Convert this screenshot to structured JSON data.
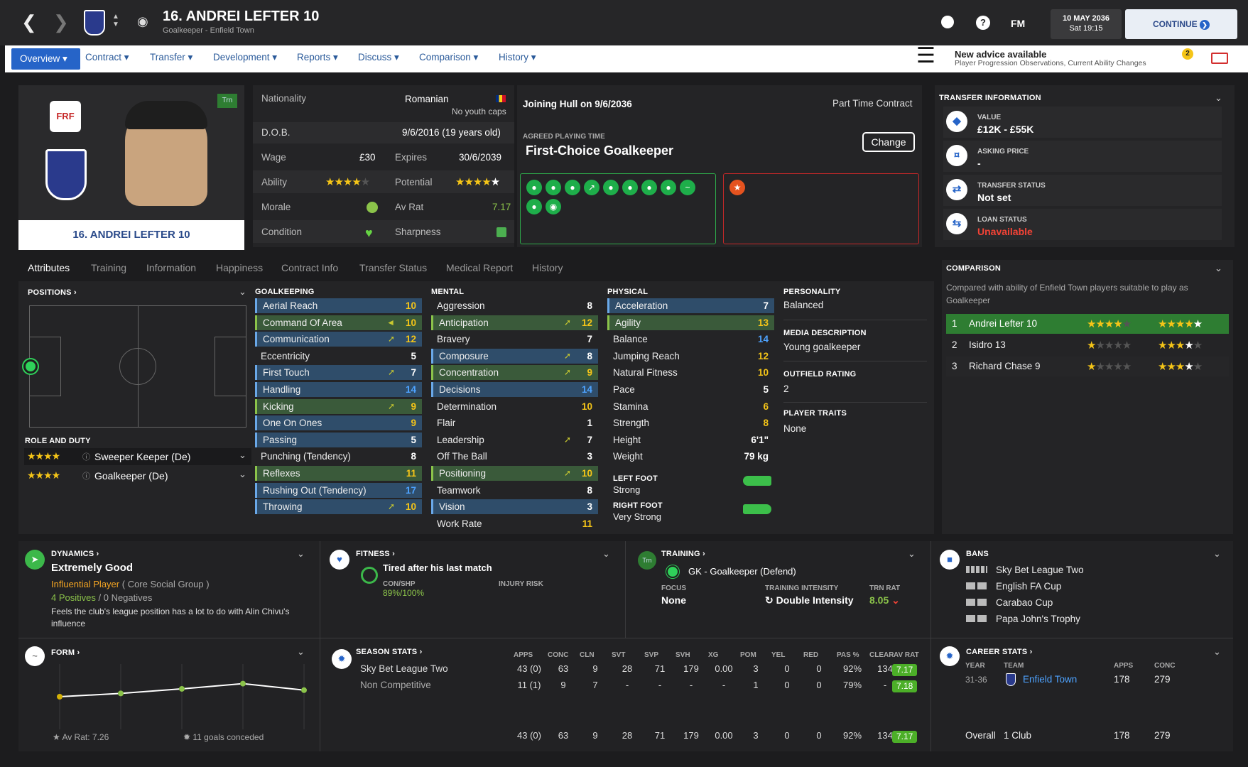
{
  "header": {
    "title": "16. ANDREI LEFTER 10",
    "subtitle": "Goalkeeper - Enfield Town",
    "fm": "FM",
    "date": "10 MAY 2036",
    "time": "Sat 19:15",
    "continue": "CONTINUE"
  },
  "menu": [
    "Overview",
    "Contract",
    "Transfer",
    "Development",
    "Reports",
    "Discuss",
    "Comparison",
    "History"
  ],
  "advice": {
    "title": "New advice available",
    "sub": "Player Progression Observations, Current Ability Changes",
    "count": "2"
  },
  "profile": {
    "name_plate": "16. ANDREI LEFTER 10",
    "trn": "Trn"
  },
  "info": {
    "nationality_label": "Nationality",
    "nationality": "Romanian",
    "youth_caps": "No youth caps",
    "dob_label": "D.O.B.",
    "dob": "9/6/2016 (19 years old)",
    "wage_label": "Wage",
    "wage": "£30",
    "expires_label": "Expires",
    "expires": "30/6/2039",
    "ability_label": "Ability",
    "potential_label": "Potential",
    "morale_label": "Morale",
    "avrat_label": "Av Rat",
    "avrat": "7.17",
    "condition_label": "Condition",
    "sharpness_label": "Sharpness"
  },
  "contract": {
    "joining": "Joining Hull on 9/6/2036",
    "type": "Part Time Contract",
    "apt_label": "AGREED PLAYING TIME",
    "apt": "First-Choice Goalkeeper",
    "change": "Change"
  },
  "transfer": {
    "header": "TRANSFER INFORMATION",
    "value_label": "VALUE",
    "value": "£12K - £55K",
    "asking_label": "ASKING PRICE",
    "asking": "-",
    "status_label": "TRANSFER STATUS",
    "status": "Not set",
    "loan_label": "LOAN STATUS",
    "loan": "Unavailable"
  },
  "comparison": {
    "header": "COMPARISON",
    "desc": "Compared with ability of Enfield Town players suitable to play as Goalkeeper",
    "rows": [
      {
        "rank": "1",
        "name": "Andrei Lefter 10"
      },
      {
        "rank": "2",
        "name": "Isidro 13"
      },
      {
        "rank": "3",
        "name": "Richard Chase 9"
      }
    ]
  },
  "tabs": [
    "Attributes",
    "Training",
    "Information",
    "Happiness",
    "Contract Info",
    "Transfer Status",
    "Medical Report",
    "History"
  ],
  "positions": {
    "header": "POSITIONS",
    "role_header": "ROLE AND DUTY",
    "roles": [
      "Sweeper Keeper (De)",
      "Goalkeeper (De)"
    ]
  },
  "goalkeeping": {
    "header": "GOALKEEPING",
    "items": [
      [
        "Aerial Reach",
        "10"
      ],
      [
        "Command Of Area",
        "10"
      ],
      [
        "Communication",
        "12"
      ],
      [
        "Eccentricity",
        "5"
      ],
      [
        "First Touch",
        "7"
      ],
      [
        "Handling",
        "14"
      ],
      [
        "Kicking",
        "9"
      ],
      [
        "One On Ones",
        "9"
      ],
      [
        "Passing",
        "5"
      ],
      [
        "Punching (Tendency)",
        "8"
      ],
      [
        "Reflexes",
        "11"
      ],
      [
        "Rushing Out (Tendency)",
        "17"
      ],
      [
        "Throwing",
        "10"
      ]
    ]
  },
  "mental": {
    "header": "MENTAL",
    "items": [
      [
        "Aggression",
        "8"
      ],
      [
        "Anticipation",
        "12"
      ],
      [
        "Bravery",
        "7"
      ],
      [
        "Composure",
        "8"
      ],
      [
        "Concentration",
        "9"
      ],
      [
        "Decisions",
        "14"
      ],
      [
        "Determination",
        "10"
      ],
      [
        "Flair",
        "1"
      ],
      [
        "Leadership",
        "7"
      ],
      [
        "Off The Ball",
        "3"
      ],
      [
        "Positioning",
        "10"
      ],
      [
        "Teamwork",
        "8"
      ],
      [
        "Vision",
        "3"
      ],
      [
        "Work Rate",
        "11"
      ]
    ]
  },
  "physical": {
    "header": "PHYSICAL",
    "items": [
      [
        "Acceleration",
        "7"
      ],
      [
        "Agility",
        "13"
      ],
      [
        "Balance",
        "14"
      ],
      [
        "Jumping Reach",
        "12"
      ],
      [
        "Natural Fitness",
        "10"
      ],
      [
        "Pace",
        "5"
      ],
      [
        "Stamina",
        "6"
      ],
      [
        "Strength",
        "8"
      ],
      [
        "Height",
        "6'1\""
      ],
      [
        "Weight",
        "79 kg"
      ]
    ],
    "left_foot_label": "LEFT FOOT",
    "left_foot": "Strong",
    "right_foot_label": "RIGHT FOOT",
    "right_foot": "Very Strong"
  },
  "personality": {
    "p_label": "PERSONALITY",
    "p": "Balanced",
    "m_label": "MEDIA DESCRIPTION",
    "m": "Young goalkeeper",
    "o_label": "OUTFIELD RATING",
    "o": "2",
    "t_label": "PLAYER TRAITS",
    "t": "None"
  },
  "dynamics": {
    "header": "DYNAMICS",
    "status": "Extremely Good",
    "group_a": "Influential Player",
    "group_b": "( Core Social Group )",
    "pos": "4 Positives",
    "neg": "/ 0 Negatives",
    "note": "Feels the club's league position has a lot to do with Alin Chivu's influence"
  },
  "fitness": {
    "header": "FITNESS",
    "status": "Tired after his last match",
    "conshp_label": "CON/SHP",
    "con": "89%",
    "shp": "/100%",
    "injury_label": "INJURY RISK"
  },
  "training": {
    "header": "TRAINING",
    "trn": "Trn",
    "role": "GK - Goalkeeper (Defend)",
    "focus_label": "FOCUS",
    "focus": "None",
    "intensity_label": "TRAINING INTENSITY",
    "intensity": "Double Intensity",
    "rat_label": "TRN RAT",
    "rat": "8.05"
  },
  "bans": {
    "header": "BANS",
    "items": [
      "Sky Bet League Two",
      "English FA Cup",
      "Carabao Cup",
      "Papa John's Trophy"
    ]
  },
  "form": {
    "header": "FORM",
    "avrat": "Av Rat: 7.26",
    "goals": "11 goals conceded"
  },
  "form_data": {
    "type": "line",
    "values": [
      7.0,
      7.05,
      7.12,
      7.2,
      7.1
    ]
  },
  "season": {
    "header": "SEASON STATS",
    "cols": [
      "APPS",
      "CONC",
      "CLN",
      "SVT",
      "SVP",
      "SVH",
      "XG",
      "POM",
      "YEL",
      "RED",
      "PAS %",
      "CLEAR",
      "AV RAT"
    ],
    "rows": [
      {
        "name": "Sky Bet League Two",
        "vals": [
          "43 (0)",
          "63",
          "9",
          "28",
          "71",
          "179",
          "0.00",
          "3",
          "0",
          "0",
          "92%",
          "134"
        ],
        "rat": "7.17"
      },
      {
        "name": "Non Competitive",
        "vals": [
          "11 (1)",
          "9",
          "7",
          "-",
          "-",
          "-",
          "-",
          "1",
          "0",
          "0",
          "79%",
          "-"
        ],
        "rat": "7.18"
      }
    ],
    "total": {
      "vals": [
        "43 (0)",
        "63",
        "9",
        "28",
        "71",
        "179",
        "0.00",
        "3",
        "0",
        "0",
        "92%",
        "134"
      ],
      "rat": "7.17"
    }
  },
  "career": {
    "header": "CAREER STATS",
    "col_year": "YEAR",
    "col_team": "TEAM",
    "col_apps": "APPS",
    "col_conc": "CONC",
    "year": "31-36",
    "team": "Enfield Town",
    "apps": "178",
    "conc": "279",
    "overall": "Overall",
    "clubs": "1 Club",
    "o_apps": "178",
    "o_conc": "279"
  },
  "colors": {
    "accent": "#2664c8",
    "positive": "#8bc34a",
    "warning": "#f5c518",
    "danger": "#e53935"
  }
}
